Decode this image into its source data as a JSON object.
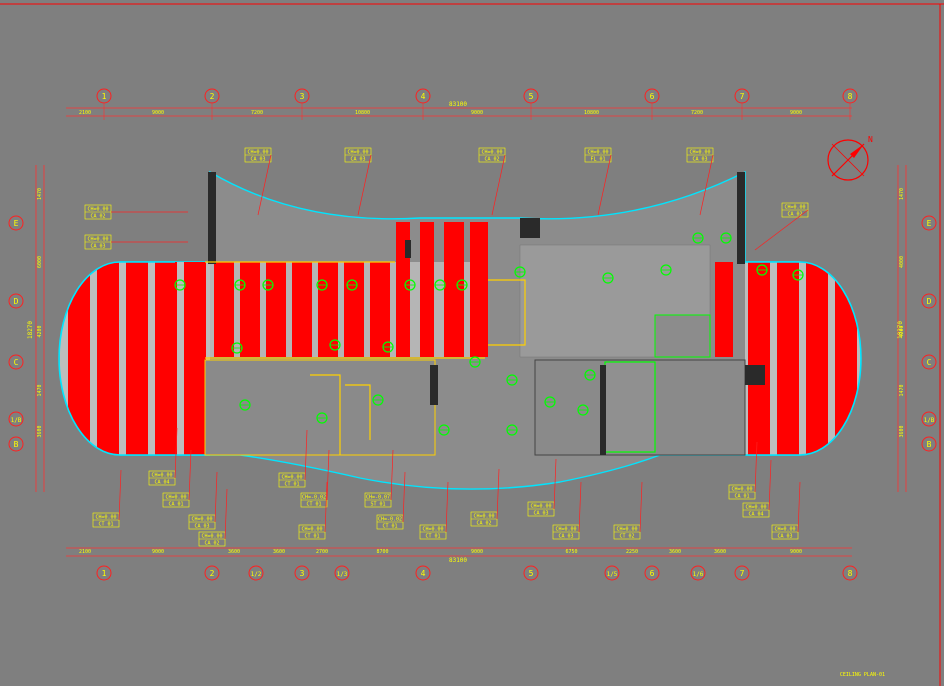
{
  "drawing": {
    "title_block_text": "CEILING PLAN-01",
    "north_label": "N",
    "overall_dimension_top": "83100",
    "overall_dimension_bottom": "83100"
  },
  "grid_top": [
    "1",
    "2",
    "3",
    "4",
    "5",
    "6",
    "7",
    "8"
  ],
  "grid_bottom": [
    "1",
    "2",
    "1/2",
    "3",
    "1/3",
    "4",
    "5",
    "1/5",
    "6",
    "1/6",
    "7",
    "8"
  ],
  "grid_left": [
    "E",
    "D",
    "C",
    "1/B",
    "B"
  ],
  "grid_right": [
    "E",
    "D",
    "C",
    "1/B",
    "B"
  ],
  "dims_top": [
    "2100",
    "9000",
    "7200",
    "10800",
    "9000",
    "10800",
    "7200",
    "9000"
  ],
  "dims_bottom": [
    "2100",
    "9000",
    "3600",
    "3600",
    "2700",
    "8700",
    "9000",
    "6750",
    "2250",
    "3600",
    "3600",
    "9000"
  ],
  "dims_left": [
    "1470",
    "6000",
    "4200",
    "1470",
    "3600"
  ],
  "dims_right": [
    "1470",
    "4000",
    "4200",
    "1470",
    "3600"
  ],
  "dim_left_total": "18270",
  "dim_right_total": "18270",
  "tags": [
    {
      "h": "CH=0.00",
      "c": "CA 03"
    },
    {
      "h": "CH=0.00",
      "c": "CA 03"
    },
    {
      "h": "CH=0.00",
      "c": "CA 02"
    },
    {
      "h": "CH=0.00",
      "c": "FL 01"
    },
    {
      "h": "CH=0.00",
      "c": "CA 03"
    },
    {
      "h": "CH=0.00",
      "c": "CA 02"
    },
    {
      "h": "CH=0.00",
      "c": "CA 03"
    },
    {
      "h": "CH=0.00",
      "c": "CA 02"
    },
    {
      "h": "CH=0.00",
      "c": "CA 04"
    },
    {
      "h": "CH=0.00",
      "c": "CA 01"
    },
    {
      "h": "CH=0.00",
      "c": "CA 03"
    },
    {
      "h": "CH=0.00",
      "c": "CA 02"
    },
    {
      "h": "CH=0.00",
      "c": "CT 01"
    },
    {
      "h": "CH=0.00",
      "c": "CT 01"
    },
    {
      "h": "CH=-0.02",
      "c": "CT 01"
    },
    {
      "h": "CH=-0.07",
      "c": "ST 01"
    },
    {
      "h": "CH=0.00",
      "c": "CT 01"
    },
    {
      "h": "CH=-0.02",
      "c": "CT 01"
    },
    {
      "h": "CH=0.00",
      "c": "CT 01"
    },
    {
      "h": "CH=0.00",
      "c": "CA 02"
    },
    {
      "h": "CH=0.00",
      "c": "CA 03"
    },
    {
      "h": "CH=0.00",
      "c": "CA 03"
    },
    {
      "h": "CH=0.00",
      "c": "CT 02"
    },
    {
      "h": "CH=0.00",
      "c": "CA 01"
    },
    {
      "h": "CH=0.00",
      "c": "CA 04"
    },
    {
      "h": "CH=0.00",
      "c": "CA 03"
    }
  ]
}
